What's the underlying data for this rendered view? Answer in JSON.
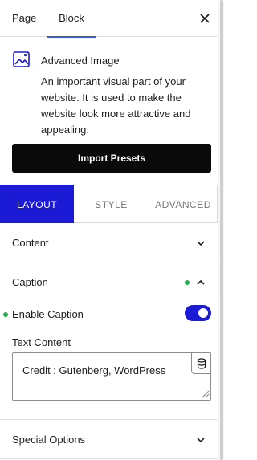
{
  "sidebar_tabs": [
    {
      "label": "Page"
    },
    {
      "label": "Block"
    }
  ],
  "block_card": {
    "title": "Advanced Image",
    "description": "An important visual part of your website. It is used to make the website look more attractive and appealing.",
    "icon": "image-icon"
  },
  "import_button": {
    "label": "Import Presets"
  },
  "panel_tabs": [
    {
      "label": "LAYOUT",
      "active": true
    },
    {
      "label": "STYLE"
    },
    {
      "label": "ADVANCED"
    }
  ],
  "sections": {
    "content": {
      "label": "Content",
      "expanded": false
    },
    "caption": {
      "label": "Caption",
      "expanded": true
    },
    "special_options": {
      "label": "Special Options",
      "expanded": false
    }
  },
  "caption_panel": {
    "enable_caption_label": "Enable Caption",
    "enable_caption_on": true,
    "text_content_label": "Text Content",
    "text_content_value": "Credit : Gutenberg, WordPress"
  },
  "colors": {
    "accent_blue": "#1b1bd6",
    "tab_underline": "#3858e9",
    "indicator_green": "#22b04b",
    "button_black": "#0a0a0a"
  }
}
